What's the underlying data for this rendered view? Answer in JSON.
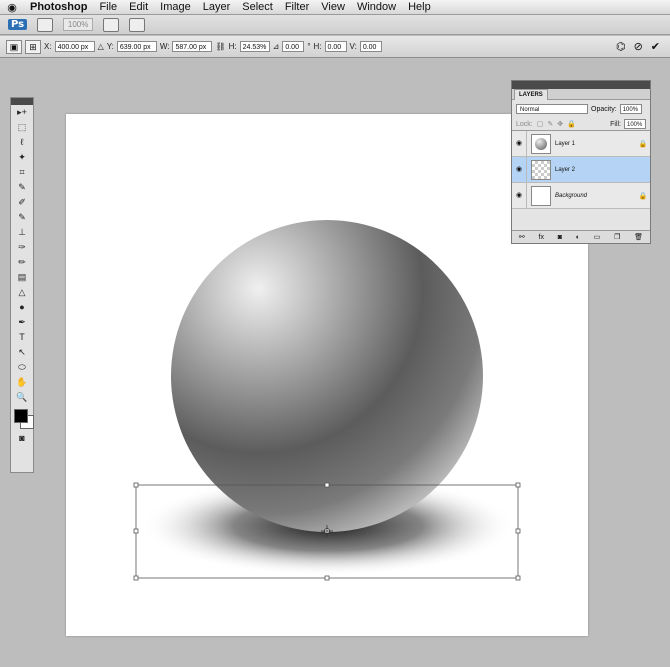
{
  "menubar": {
    "apple": "",
    "app": "Photoshop",
    "items": [
      "File",
      "Edit",
      "Image",
      "Layer",
      "Select",
      "Filter",
      "View",
      "Window",
      "Help"
    ]
  },
  "appbar": {
    "logo": "Ps",
    "zoom": "100%"
  },
  "options": {
    "x_label": "X:",
    "x_value": "400.00 px",
    "y_label": "Y:",
    "y_value": "639.00 px",
    "w_label": "W:",
    "w_value": "587.00 px",
    "h_label": "H:",
    "h_value": "24.53%",
    "angle_value": "0.00",
    "deg": "°",
    "hskew_label": "H:",
    "hskew_value": "0.00",
    "vskew_label": "V:",
    "vskew_value": "0.00"
  },
  "tools": [
    "▸+",
    "⬚",
    "ℓ",
    "✦",
    "⌗",
    "✎",
    "✐",
    "✎",
    "⊥",
    "✑",
    "✏",
    "▤",
    "△",
    "●",
    "✒",
    "T",
    "↖",
    "⬭",
    "✋",
    "🔍"
  ],
  "layers_panel": {
    "tab": "LAYERS",
    "blend_mode": "Normal",
    "opacity_label": "Opacity:",
    "opacity": "100%",
    "lock_label": "Lock:",
    "fill_label": "Fill:",
    "fill": "100%",
    "layers": [
      {
        "name": "Layer 1",
        "selected": false
      },
      {
        "name": "Layer 2",
        "selected": true
      },
      {
        "name": "Background",
        "selected": false
      }
    ]
  }
}
